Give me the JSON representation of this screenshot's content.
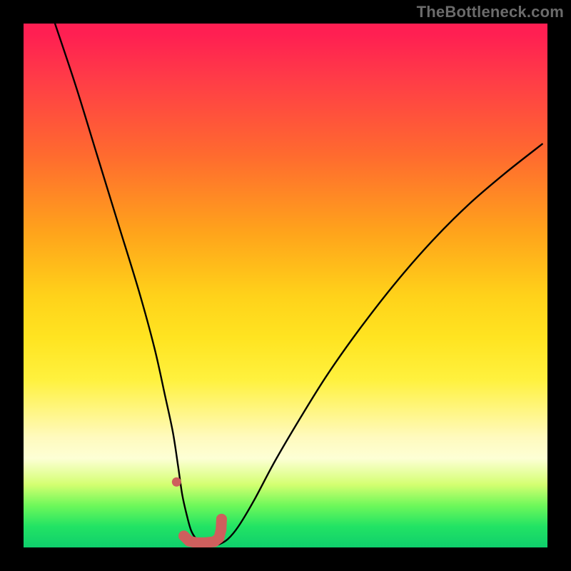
{
  "watermark": "TheBottleneck.com",
  "chart_data": {
    "type": "line",
    "title": "",
    "xlabel": "",
    "ylabel": "",
    "xlim": [
      0,
      100
    ],
    "ylim": [
      0,
      100
    ],
    "series": [
      {
        "name": "bottleneck-curve",
        "x": [
          6,
          10,
          14,
          18,
          22,
          25,
          27,
          28.5,
          29.5,
          30.3,
          31.2,
          32.0,
          33.0,
          34.3,
          35.8,
          37.3,
          39.0,
          41.0,
          44.0,
          48.0,
          53.0,
          58.0,
          64.0,
          71.0,
          78.0,
          85.0,
          92.0,
          99.0
        ],
        "values": [
          100,
          88,
          75,
          62,
          49,
          38,
          29,
          22,
          15.5,
          10.0,
          6.0,
          3.2,
          1.6,
          0.7,
          0.4,
          0.6,
          1.6,
          4.0,
          9.0,
          16.5,
          25.0,
          33.0,
          41.5,
          50.5,
          58.5,
          65.5,
          71.5,
          77.0
        ]
      },
      {
        "name": "sweet-spot-markers",
        "x": [
          29.2,
          30.6,
          31.6,
          33.0,
          34.6,
          36.4,
          37.3,
          37.7,
          37.8
        ],
        "values": [
          12.5,
          2.2,
          1.2,
          0.9,
          0.9,
          1.1,
          1.8,
          3.4,
          5.4
        ]
      }
    ],
    "background_gradient": {
      "stops": [
        {
          "pos": 0.0,
          "color": "#ff1f52"
        },
        {
          "pos": 0.25,
          "color": "#ff6a2f"
        },
        {
          "pos": 0.52,
          "color": "#ffd21a"
        },
        {
          "pos": 0.79,
          "color": "#fffabe"
        },
        {
          "pos": 0.92,
          "color": "#6ef85a"
        },
        {
          "pos": 1.0,
          "color": "#0fcf6c"
        }
      ]
    },
    "curve_color": "#000000",
    "marker_color": "#ce5f5d"
  }
}
